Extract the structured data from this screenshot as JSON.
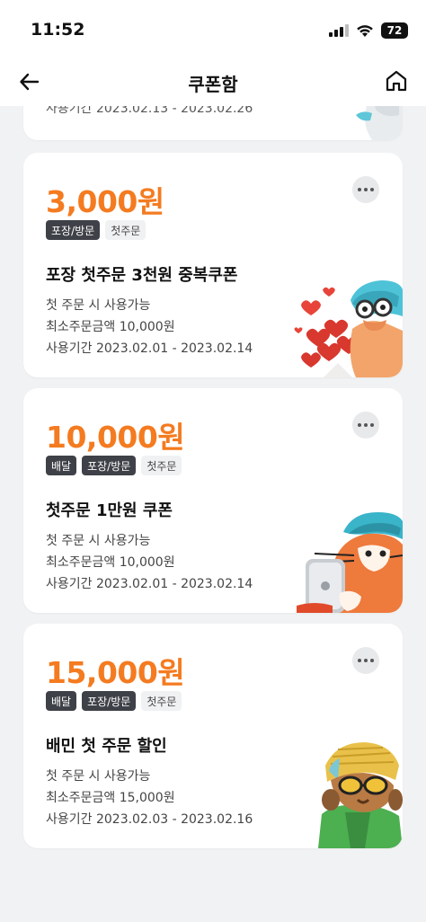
{
  "status_bar": {
    "time": "11:52",
    "battery": "72"
  },
  "header": {
    "title": "쿠폰함"
  },
  "partial_coupon": {
    "period": "사용기간 2023.02.13 - 2023.02.26"
  },
  "coupons": [
    {
      "amount": "3,000원",
      "tags": [
        {
          "label": "포장/방문",
          "style": "dark"
        },
        {
          "label": "첫주문",
          "style": "light"
        }
      ],
      "name": "포장 첫주문 3천원 중복쿠폰",
      "condition": "첫 주문 시 사용가능",
      "min_order": "최소주문금액 10,000원",
      "period": "사용기간 2023.02.01 - 2023.02.14",
      "illustration": "character-with-hearts-icon"
    },
    {
      "amount": "10,000원",
      "tags": [
        {
          "label": "배달",
          "style": "dark"
        },
        {
          "label": "포장/방문",
          "style": "dark"
        },
        {
          "label": "첫주문",
          "style": "light"
        }
      ],
      "name": "첫주문 1만원 쿠폰",
      "condition": "첫 주문 시 사용가능",
      "min_order": "최소주문금액 10,000원",
      "period": "사용기간 2023.02.01 - 2023.02.14",
      "illustration": "cat-with-phone-icon"
    },
    {
      "amount": "15,000원",
      "tags": [
        {
          "label": "배달",
          "style": "dark"
        },
        {
          "label": "포장/방문",
          "style": "dark"
        },
        {
          "label": "첫주문",
          "style": "light"
        }
      ],
      "name": "배민 첫 주문 할인",
      "condition": "첫 주문 시 사용가능",
      "min_order": "최소주문금액 15,000원",
      "period": "사용기간 2023.02.03 - 2023.02.16",
      "illustration": "character-with-sunglasses-icon"
    }
  ],
  "colors": {
    "accent": "#f47b20",
    "background": "#f1f2f4",
    "tag_dark": "#3e4147",
    "tag_light": "#f0f1f3",
    "card": "#ffffff"
  }
}
